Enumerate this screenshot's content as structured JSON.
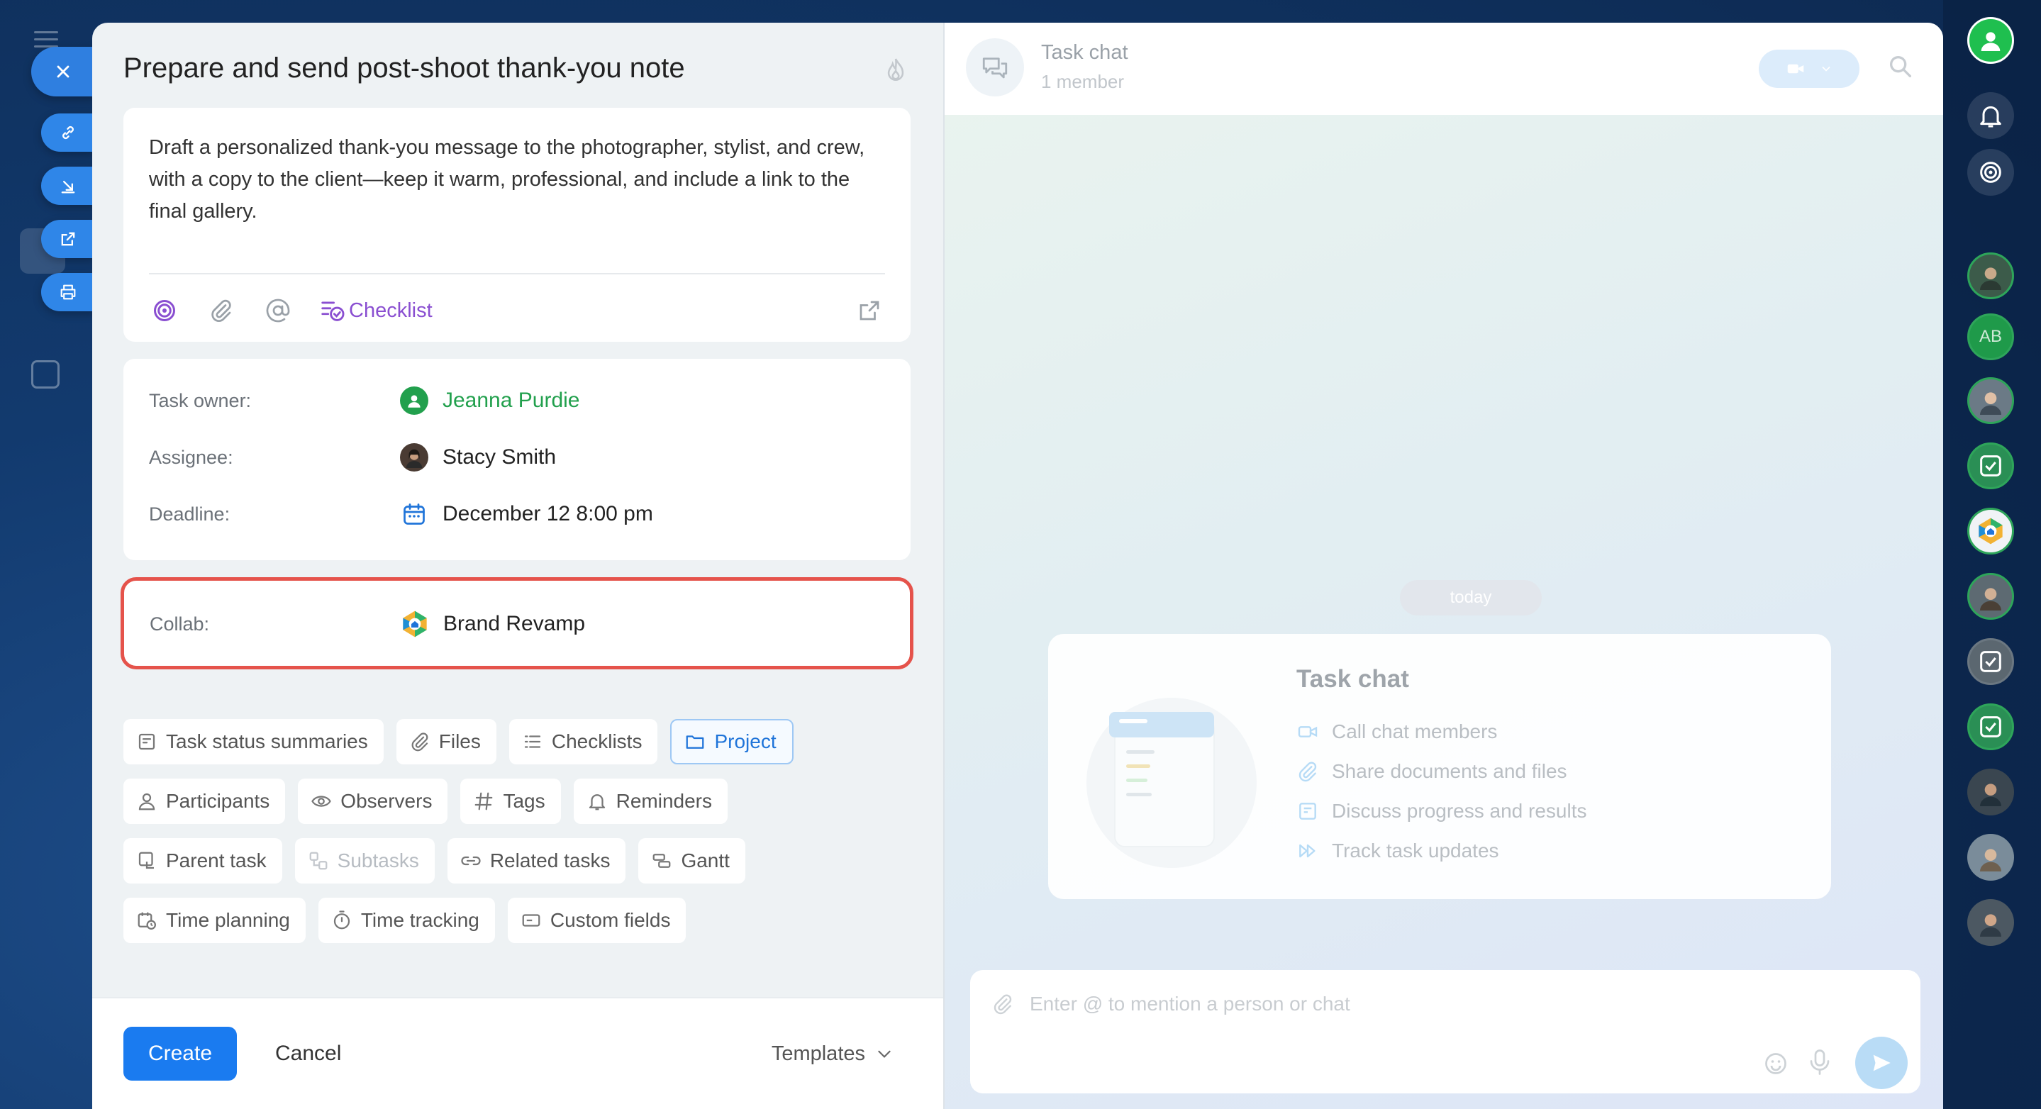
{
  "task": {
    "title": "Prepare and send post-shoot thank-you note",
    "description": "Draft a personalized thank-you message to the photographer, stylist, and crew, with a copy to the client—keep it warm, professional, and include a link to the final gallery.",
    "checklist_label": "Checklist"
  },
  "fields": {
    "owner_label": "Task owner:",
    "owner_value": "Jeanna Purdie",
    "assignee_label": "Assignee:",
    "assignee_value": "Stacy Smith",
    "deadline_label": "Deadline:",
    "deadline_value": "December 12 8:00 pm",
    "collab_label": "Collab:",
    "collab_value": "Brand Revamp"
  },
  "chips": {
    "row1": [
      "Task status summaries",
      "Files",
      "Checklists",
      "Project"
    ],
    "row2": [
      "Participants",
      "Observers",
      "Tags",
      "Reminders"
    ],
    "row3": [
      "Parent task",
      "Subtasks",
      "Related tasks",
      "Gantt"
    ],
    "row4": [
      "Time planning",
      "Time tracking",
      "Custom fields"
    ]
  },
  "footer": {
    "create_label": "Create",
    "cancel_label": "Cancel",
    "templates_label": "Templates"
  },
  "chat": {
    "title": "Task chat",
    "subtitle": "1 member",
    "today_label": "today",
    "promo_title": "Task chat",
    "promo_items": [
      "Call chat members",
      "Share documents and files",
      "Discuss progress and results",
      "Track task updates"
    ],
    "composer_placeholder": "Enter @ to mention a person or chat"
  },
  "rail": {
    "initials": "AB"
  },
  "colors": {
    "accent_blue": "#1a7bf0",
    "owner_green": "#22a04d",
    "checklist_purple": "#8a4fd1",
    "highlight_red": "#e5534b"
  }
}
